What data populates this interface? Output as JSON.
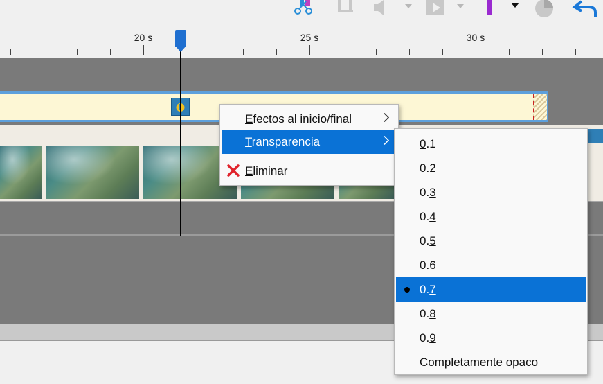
{
  "ruler": {
    "labels": [
      "20 s",
      "25 s",
      "30 s"
    ]
  },
  "context_menu": {
    "items": [
      {
        "prefix": "",
        "accel": "E",
        "rest": "fectos al inicio/final",
        "has_submenu": true
      },
      {
        "prefix": "",
        "accel": "T",
        "rest": "ransparencia",
        "has_submenu": true,
        "highlighted": true
      },
      {
        "prefix": "",
        "accel": "E",
        "rest": "liminar",
        "icon": "red-x-icon"
      }
    ],
    "submenu_arrow": ">"
  },
  "transparency_submenu": {
    "items": [
      {
        "prefix": "",
        "accel": "0",
        "rest": ".1"
      },
      {
        "prefix": "0.",
        "accel": "2",
        "rest": ""
      },
      {
        "prefix": "0.",
        "accel": "3",
        "rest": ""
      },
      {
        "prefix": "0.",
        "accel": "4",
        "rest": ""
      },
      {
        "prefix": "0.",
        "accel": "5",
        "rest": ""
      },
      {
        "prefix": "0.",
        "accel": "6",
        "rest": ""
      },
      {
        "prefix": "0.",
        "accel": "7",
        "rest": "",
        "selected": true
      },
      {
        "prefix": "0.",
        "accel": "8",
        "rest": ""
      },
      {
        "prefix": "0.",
        "accel": "9",
        "rest": ""
      },
      {
        "prefix": "",
        "accel": "C",
        "rest": "ompletamente opaco"
      }
    ]
  },
  "colors": {
    "highlight": "#0a72d6",
    "playhead": "#1f6fd0",
    "clip_border": "#5da0dc",
    "clip_fill": "#fdf7d5",
    "track_bg": "#7a7a7a",
    "delete_icon": "#e0232b"
  },
  "toolbar": {
    "icons": [
      "scissors-split-icon",
      "crop-icon",
      "volume-icon",
      "playback-icon",
      "marker-icon",
      "effect-icon",
      "undo-icon"
    ]
  }
}
